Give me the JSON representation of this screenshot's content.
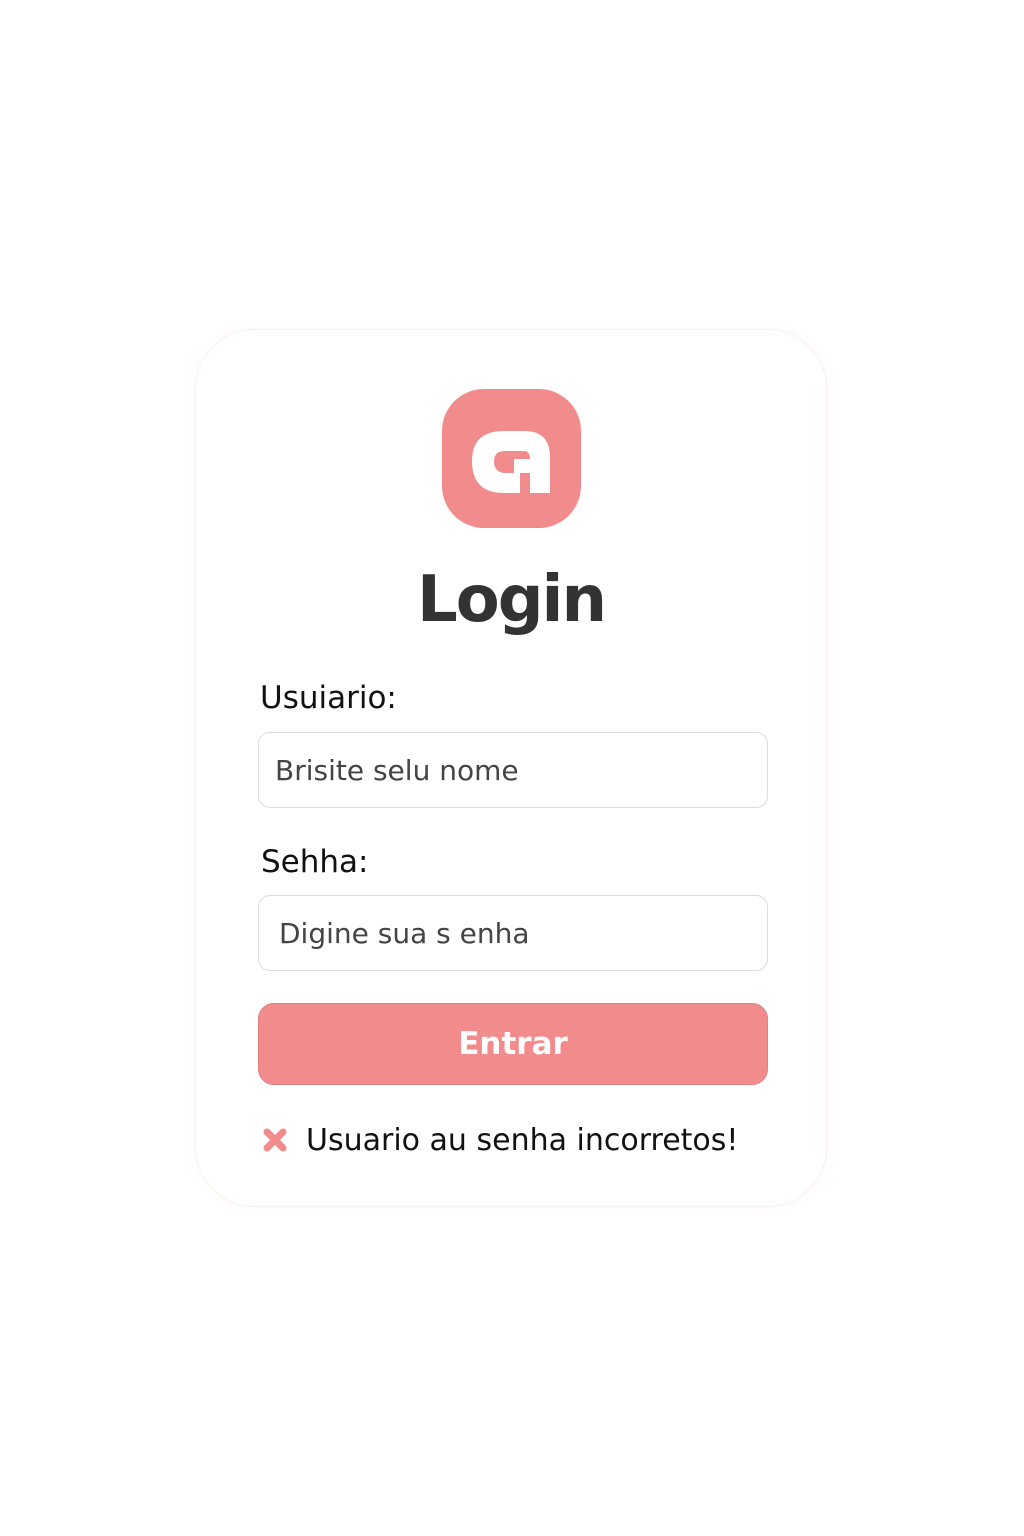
{
  "app": {
    "logo_icon": "stylized-a-logo-icon",
    "accent_color": "#f28b8b"
  },
  "login": {
    "title": "Login",
    "username": {
      "label": "Usuiario:",
      "placeholder": "Brisite selu nome",
      "value": ""
    },
    "password": {
      "label": "Sehha:",
      "placeholder": "Digine sua s enha",
      "value": ""
    },
    "submit_label": "Entrar",
    "error": {
      "icon": "close-icon",
      "message": "Usuario au senha incorretos!",
      "color": "#f28b8b"
    }
  }
}
